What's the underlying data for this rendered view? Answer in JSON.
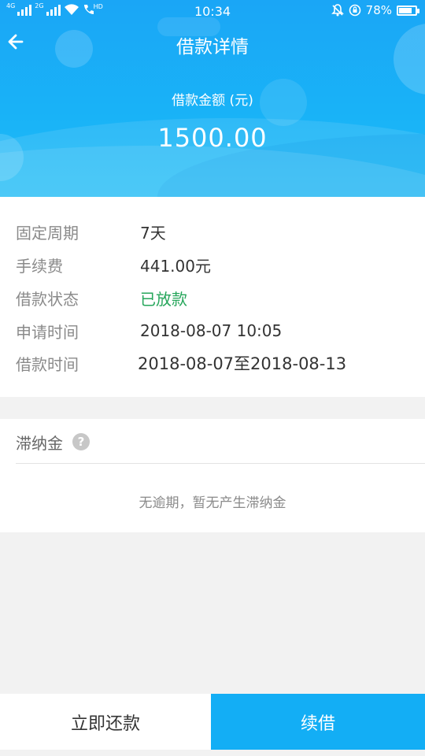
{
  "status_bar": {
    "time": "10:34",
    "network1": "4G",
    "network2": "2G",
    "hd_label": "HD",
    "battery_text": "78%",
    "battery_level": 0.78
  },
  "header": {
    "title": "借款详情",
    "amount_label": "借款金额 (元)",
    "amount": "1500.00"
  },
  "details": [
    {
      "label": "固定周期",
      "value": "7天"
    },
    {
      "label": "手续费",
      "value": "441.00元"
    },
    {
      "label": "借款状态",
      "value": "已放款"
    },
    {
      "label": "申请时间",
      "value": "2018-08-07 10:05"
    },
    {
      "label": "借款时间",
      "value": "2018-08-07至2018-08-13"
    }
  ],
  "late_fee": {
    "title": "滞纳金",
    "help": "?",
    "message": "无逾期，暂无产生滞纳金"
  },
  "bottom_bar": {
    "repay_label": "立即还款",
    "renew_label": "续借"
  },
  "colors": {
    "primary": "#13aef5",
    "status_green": "#26a65b"
  }
}
